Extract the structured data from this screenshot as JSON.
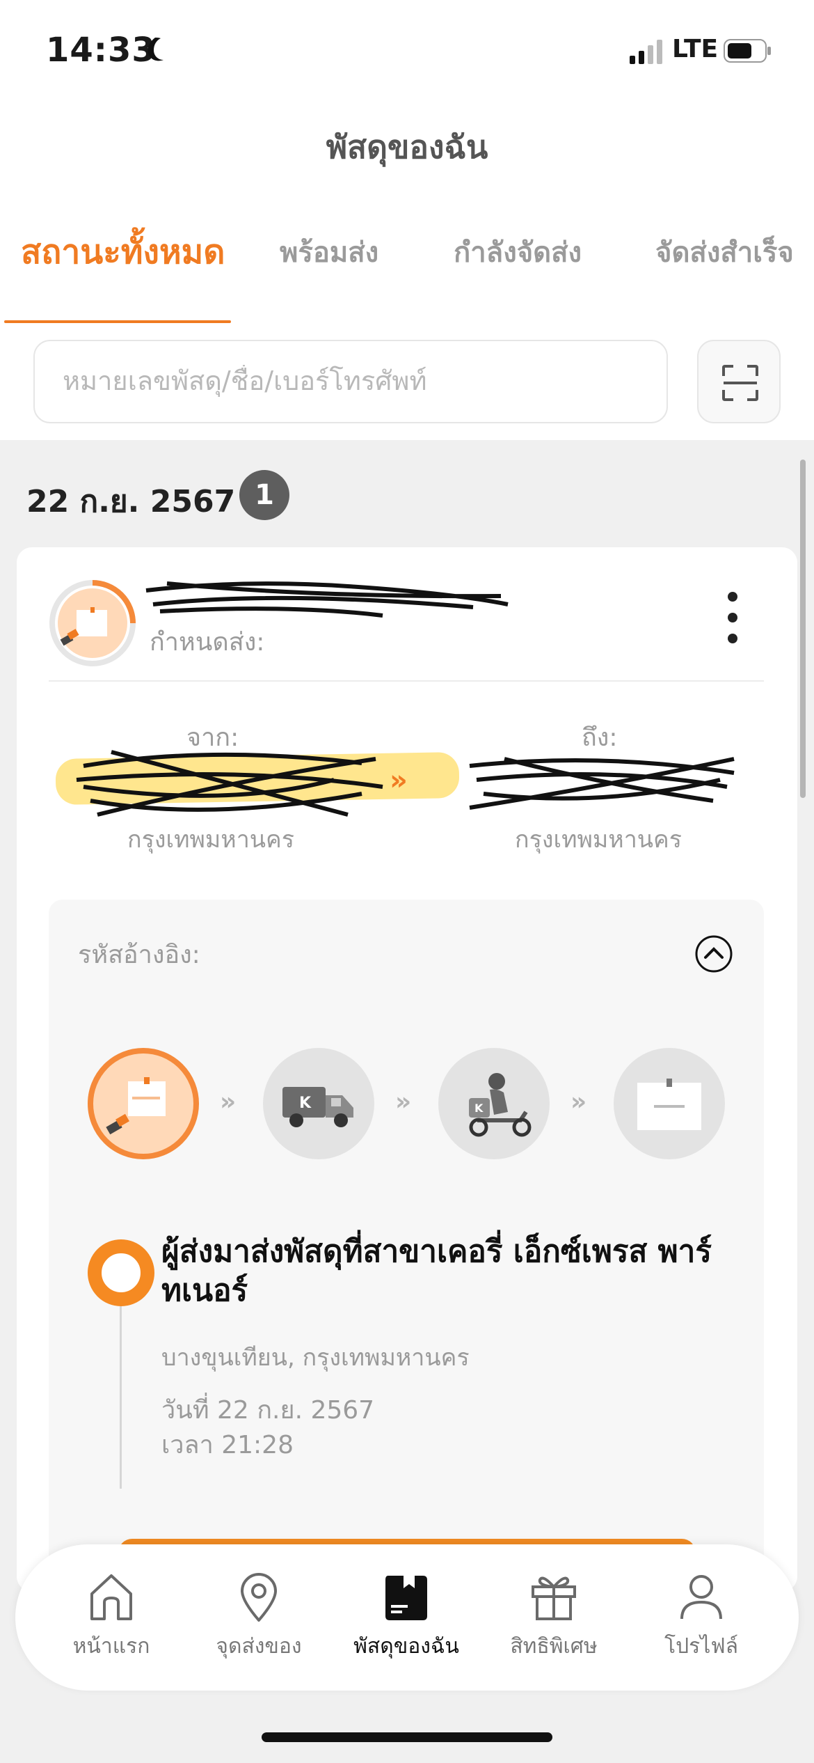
{
  "status_bar": {
    "time": "14:33",
    "network": "LTE"
  },
  "page": {
    "title": "พัสดุของฉัน"
  },
  "tabs": [
    {
      "label": "สถานะทั้งหมด",
      "active": true
    },
    {
      "label": "พร้อมส่ง",
      "active": false
    },
    {
      "label": "กำลังจัดส่ง",
      "active": false
    },
    {
      "label": "จัดส่งสำเร็จ",
      "active": false
    }
  ],
  "search": {
    "placeholder": "หมายเลขพัสดุ/ชื่อ/เบอร์โทรศัพท์",
    "value": ""
  },
  "group": {
    "date": "22 ก.ย. 2567",
    "count": "1"
  },
  "parcel": {
    "deadline_label": "กำหนดส่ง:",
    "from_label": "จาก:",
    "to_label": "ถึง:",
    "route_arrow": "»",
    "from_city": "กรุงเทพมหานคร",
    "to_city": "กรุงเทพมหานคร",
    "reference_label": "รหัสอ้างอิง:"
  },
  "timeline": {
    "step_separator": "»",
    "event_title": "ผู้ส่งมาส่งพัสดุที่สาขาเคอรี่ เอ็กซ์เพรส พาร์ทเนอร์",
    "event_location": "บางขุนเทียน, กรุงเทพมหานคร",
    "event_date": "วันที่ 22 ก.ย. 2567",
    "event_time": "เวลา 21:28"
  },
  "bottom_nav": {
    "items": [
      {
        "label": "หน้าแรก",
        "icon": "home-icon",
        "active": false
      },
      {
        "label": "จุดส่งของ",
        "icon": "location-pin-icon",
        "active": false
      },
      {
        "label": "พัสดุของฉัน",
        "icon": "parcel-icon",
        "active": true
      },
      {
        "label": "สิทธิพิเศษ",
        "icon": "gift-icon",
        "active": false
      },
      {
        "label": "โปรไฟล์",
        "icon": "profile-icon",
        "active": false
      }
    ]
  },
  "colors": {
    "accent": "#f07b22",
    "inactive_text": "#9a9a9a",
    "panel": "#f7f7f7",
    "background": "#f0f0f0"
  }
}
